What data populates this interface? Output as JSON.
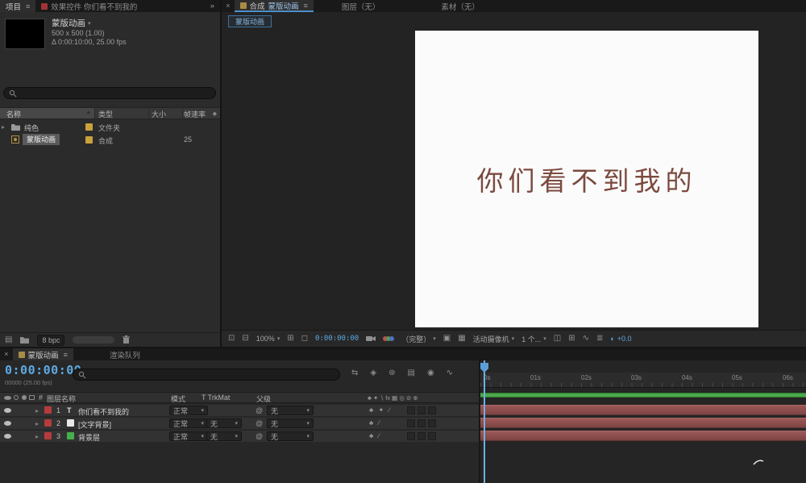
{
  "project": {
    "tab_project": "项目",
    "tab_effect_controls": "效果控件 你们看不到我的",
    "overflow_icon": "»",
    "info": {
      "name": "蒙版动画",
      "size": "500 x 500 (1.00)",
      "duration": "Δ 0:00:10:00, 25.00 fps"
    },
    "columns": {
      "name": "名称",
      "type": "类型",
      "size": "大小",
      "fps": "帧速率"
    },
    "items": [
      {
        "name": "纯色",
        "type": "文件夹",
        "fps": ""
      },
      {
        "name": "蒙版动画",
        "type": "合成",
        "fps": "25"
      }
    ],
    "footer_bpc": "8 bpc"
  },
  "comp": {
    "close": "×",
    "tab_prefix": "合成",
    "tab_name": "蒙版动画",
    "tab_layer": "图层（无）",
    "tab_footage": "素材（无）",
    "viewer_tab": "蒙版动画",
    "canvas_text": "你们看不到我的",
    "toolbar": {
      "zoom": "100%",
      "timecode": "0:00:00:00",
      "resolution": "（完整）",
      "camera": "活动摄像机",
      "views": "1 个...",
      "exposure": "+0.0"
    }
  },
  "timeline": {
    "close": "×",
    "tab_name": "蒙版动画",
    "tab_render_queue": "渲染队列",
    "timecode": "0:00:00:00",
    "frames_info": "00000 (25.00 fps)",
    "columns": {
      "hash": "#",
      "name": "图层名称",
      "mode": "模式",
      "trkmat": "T TrkMat",
      "parent": "父级"
    },
    "switches_header": "♣ ✦ ∖ fx ▦ ◎ ⊘ ⊕",
    "layers": [
      {
        "num": "1",
        "icon_glyph": "T",
        "name": "你们看不到我的",
        "mode": "正常",
        "parent": "无",
        "switches": "♣ ✦ ∕"
      },
      {
        "num": "2",
        "name": "[文字背景]",
        "mode": "正常",
        "trkmat": "无",
        "parent": "无",
        "switches": "♣ ∕"
      },
      {
        "num": "3",
        "name": "背景层",
        "mode": "正常",
        "trkmat": "无",
        "parent": "无",
        "switches": "♣ ∕"
      }
    ],
    "ruler": [
      "0s",
      "01s",
      "02s",
      "03s",
      "04s",
      "05s",
      "06s"
    ]
  },
  "colors": {
    "accent_blue": "#5da9e2",
    "label_red": "#b53c3c",
    "label_yellow": "#c9a23c",
    "solid_green": "#46ae4c",
    "layer_bar": "#8d4b4b",
    "work_area_green": "#4aa84a",
    "canvas_text": "#7b4a3f"
  }
}
